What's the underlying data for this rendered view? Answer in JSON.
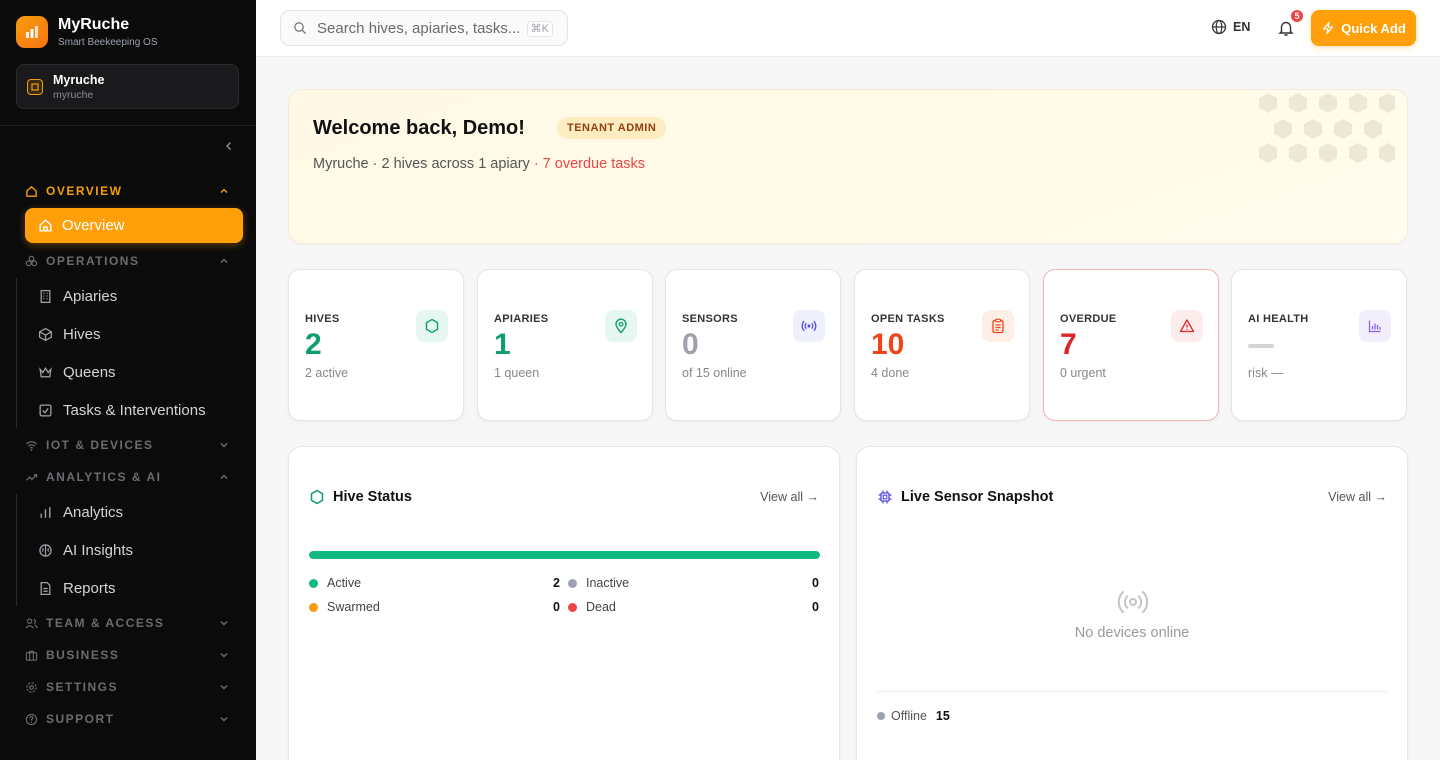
{
  "brand": {
    "name": "MyRuche",
    "tagline": "Smart Beekeeping OS"
  },
  "tenant": {
    "name": "Myruche",
    "slug": "myruche"
  },
  "sidebar": {
    "sections": [
      {
        "label": "OVERVIEW",
        "items": [
          "Overview"
        ]
      },
      {
        "label": "OPERATIONS",
        "items": [
          "Apiaries",
          "Hives",
          "Queens",
          "Tasks & Interventions"
        ]
      },
      {
        "label": "IOT & DEVICES",
        "items": []
      },
      {
        "label": "ANALYTICS & AI",
        "items": [
          "Analytics",
          "AI Insights",
          "Reports"
        ]
      },
      {
        "label": "TEAM & ACCESS",
        "items": []
      },
      {
        "label": "BUSINESS",
        "items": []
      },
      {
        "label": "SETTINGS",
        "items": []
      },
      {
        "label": "SUPPORT",
        "items": []
      }
    ],
    "active_item": "Overview"
  },
  "topbar": {
    "search_placeholder": "Search hives, apiaries, tasks...",
    "search_shortcut": "⌘K",
    "language": "EN",
    "notification_count": "5",
    "quick_add_label": "Quick Add"
  },
  "welcome": {
    "title": "Welcome back, Demo!",
    "role": "TENANT ADMIN",
    "summary": "Myruche · 2 hives across 1 apiary",
    "overdue": "· 7 overdue tasks"
  },
  "stats": [
    {
      "label": "HIVES",
      "value": "2",
      "sub": "2 active",
      "color": "#0f9f6e",
      "icon": "hexagon-icon"
    },
    {
      "label": "APIARIES",
      "value": "1",
      "sub": "1 queen",
      "color": "#0f9f6e",
      "icon": "map-pin-icon"
    },
    {
      "label": "SENSORS",
      "value": "0",
      "sub": "of 15 online",
      "color": "#a1a1aa",
      "icon": "radio-icon"
    },
    {
      "label": "OPEN TASKS",
      "value": "10",
      "sub": "4 done",
      "color": "#ef4410",
      "icon": "clipboard-icon"
    },
    {
      "label": "OVERDUE",
      "value": "7",
      "sub": "0 urgent",
      "color": "#dc2626",
      "icon": "alert-triangle-icon"
    },
    {
      "label": "AI HEALTH",
      "value": "",
      "sub": "risk —",
      "color": "#a1a1aa",
      "icon": "bar-chart-icon"
    }
  ],
  "hive_status": {
    "title": "Hive Status",
    "view_all": "View all →",
    "active_fraction": 1.0,
    "legend": [
      {
        "label": "Active",
        "count": "2",
        "color": "#10b981"
      },
      {
        "label": "Inactive",
        "count": "0",
        "color": "#9ca3af"
      },
      {
        "label": "Swarmed",
        "count": "0",
        "color": "#f59e0b"
      },
      {
        "label": "Dead",
        "count": "0",
        "color": "#ef4444"
      }
    ]
  },
  "sensor_snapshot": {
    "title": "Live Sensor Snapshot",
    "view_all": "View all →",
    "empty_text": "No devices online",
    "offline_label": "Offline",
    "offline_count": "15"
  },
  "colors": {
    "accent": "#ff9f0a",
    "sidebar_bg": "#0b0b0c",
    "success": "#10b981",
    "danger": "#ef4444"
  }
}
